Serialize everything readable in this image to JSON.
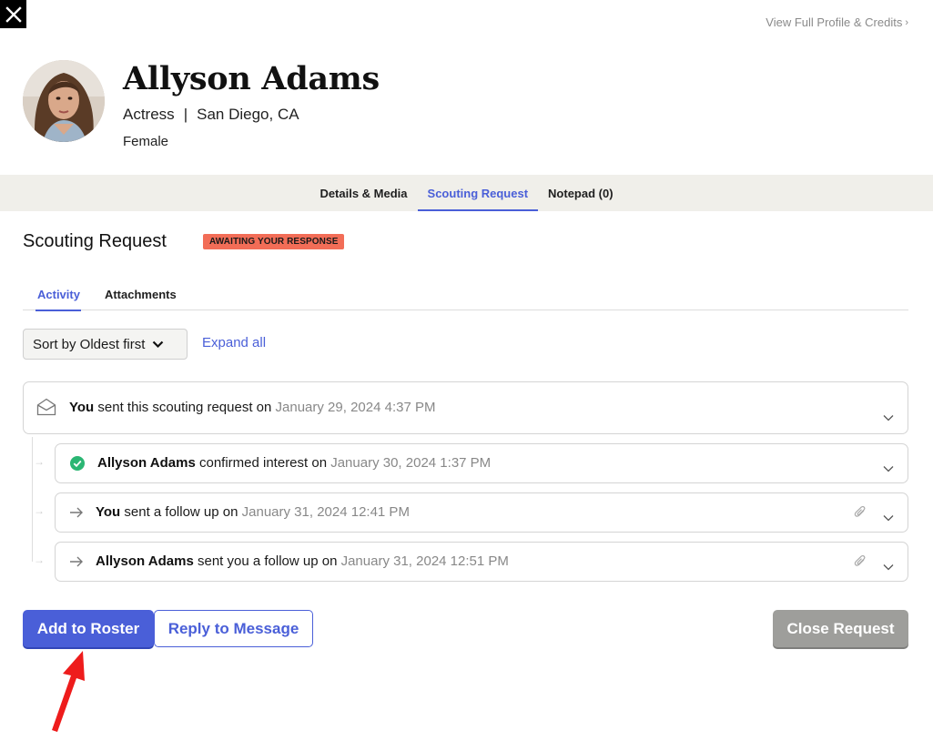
{
  "header": {
    "close_icon": "close-icon",
    "profile_link": "View Full Profile & Credits",
    "profile_link_chevron": "›"
  },
  "profile": {
    "name": "Allyson Adams",
    "role": "Actress",
    "separator": "|",
    "location": "San Diego, CA",
    "gender": "Female"
  },
  "tabs": [
    {
      "label": "Details & Media",
      "active": false
    },
    {
      "label": "Scouting Request",
      "active": true
    },
    {
      "label": "Notepad (0)",
      "active": false
    }
  ],
  "request": {
    "title": "Scouting Request",
    "status": "AWAITING YOUR RESPONSE",
    "status_color": "#f26d57"
  },
  "subtabs": [
    {
      "label": "Activity",
      "active": true
    },
    {
      "label": "Attachments",
      "active": false
    }
  ],
  "controls": {
    "sort_label": "Sort by Oldest first",
    "expand_all": "Expand all"
  },
  "activity": [
    {
      "actor": "You",
      "action": " sent this scouting request on ",
      "timestamp": "January 29, 2024 4:37 PM",
      "icon": "envelope-open-icon",
      "has_attachment": false
    },
    {
      "actor": "Allyson Adams",
      "action": " confirmed interest on ",
      "timestamp": "January 30, 2024 1:37 PM",
      "icon": "check-circle-icon",
      "has_attachment": false
    },
    {
      "actor": "You",
      "action": " sent a follow up on ",
      "timestamp": "January 31, 2024 12:41 PM",
      "icon": "arrow-right-icon",
      "has_attachment": true
    },
    {
      "actor": "Allyson Adams",
      "action": " sent you a follow up on ",
      "timestamp": "January 31, 2024 12:51 PM",
      "icon": "arrow-right-icon",
      "has_attachment": true
    }
  ],
  "actions": {
    "add_to_roster": "Add to Roster",
    "reply": "Reply to Message",
    "close_request": "Close Request"
  },
  "colors": {
    "accent": "#4a5fd8",
    "success": "#2bb673",
    "disabled": "#9e9e9b",
    "annotation": "#ee1c1c"
  }
}
